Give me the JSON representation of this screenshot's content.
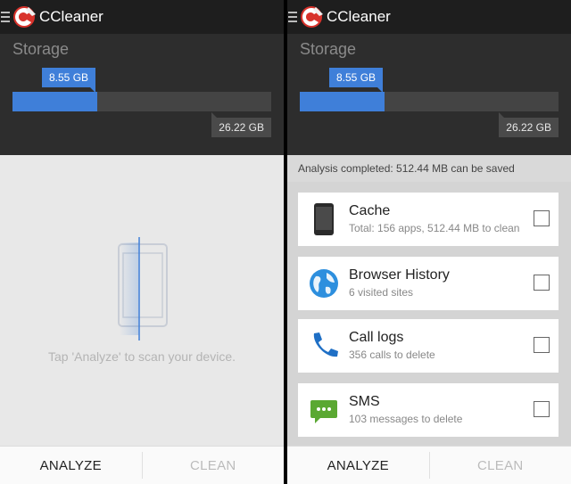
{
  "left": {
    "app_title": "CCleaner",
    "storage_label": "Storage",
    "used": "8.55 GB",
    "total": "26.22 GB",
    "used_fraction": 0.326,
    "hint": "Tap 'Analyze' to scan your device.",
    "analyze": "ANALYZE",
    "clean": "CLEAN"
  },
  "right": {
    "app_title": "CCleaner",
    "storage_label": "Storage",
    "used": "8.55 GB",
    "total": "26.22 GB",
    "used_fraction": 0.326,
    "status": "Analysis completed: 512.44 MB can be saved",
    "items": [
      {
        "title": "Cache",
        "subtitle": "Total: 156 apps, 512.44 MB to clean",
        "icon": "phone-icon"
      },
      {
        "title": "Browser History",
        "subtitle": "6 visited sites",
        "icon": "globe-icon"
      },
      {
        "title": "Call logs",
        "subtitle": "356 calls to delete",
        "icon": "telephone-icon"
      },
      {
        "title": "SMS",
        "subtitle": "103 messages to delete",
        "icon": "message-icon"
      }
    ],
    "analyze": "ANALYZE",
    "clean": "CLEAN"
  },
  "colors": {
    "accent": "#3f7fd9",
    "appbar": "#1e1e1e",
    "storage_bg": "#2d2d2d"
  }
}
